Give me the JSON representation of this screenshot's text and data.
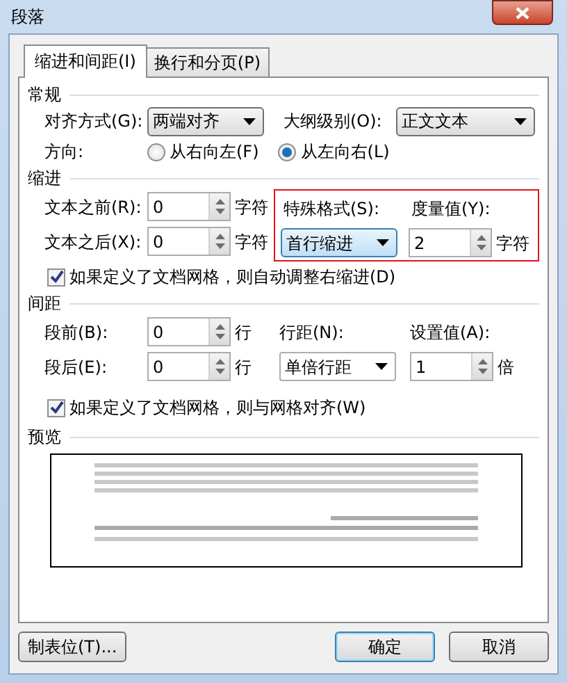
{
  "window": {
    "title": "段落"
  },
  "tabs": [
    {
      "label": "缩进和间距(I)",
      "selected": true
    },
    {
      "label": "换行和分页(P)",
      "selected": false
    }
  ],
  "general": {
    "heading": "常规",
    "alignment": {
      "label": "对齐方式(G):",
      "value": "两端对齐"
    },
    "outline_level": {
      "label": "大纲级别(O):",
      "value": "正文文本"
    },
    "direction": {
      "label": "方向:",
      "options": [
        {
          "label": "从右向左(F)",
          "selected": false
        },
        {
          "label": "从左向右(L)",
          "selected": true
        }
      ]
    }
  },
  "indent": {
    "heading": "缩进",
    "before": {
      "label": "文本之前(R):",
      "value": "0",
      "unit": "字符"
    },
    "after": {
      "label": "文本之后(X):",
      "value": "0",
      "unit": "字符"
    },
    "special": {
      "highlighted": true,
      "label": "特殊格式(S):",
      "value": "首行缩进",
      "measure_label": "度量值(Y):",
      "measure_value": "2",
      "unit": "字符"
    },
    "auto_adjust": {
      "label": "如果定义了文档网格，则自动调整右缩进(D)",
      "checked": true
    }
  },
  "spacing": {
    "heading": "间距",
    "before": {
      "label": "段前(B):",
      "value": "0",
      "unit": "行"
    },
    "after": {
      "label": "段后(E):",
      "value": "0",
      "unit": "行"
    },
    "line_spacing": {
      "label": "行距(N):",
      "value": "单倍行距"
    },
    "setting": {
      "label": "设置值(A):",
      "value": "1",
      "unit": "倍"
    },
    "snap_to_grid": {
      "label": "如果定义了文档网格，则与网格对齐(W)",
      "checked": true
    }
  },
  "preview": {
    "heading": "预览"
  },
  "buttons": [
    {
      "label": "制表位(T)...",
      "kind": "left"
    },
    {
      "label": "确定",
      "kind": "default"
    },
    {
      "label": "取消",
      "kind": "normal"
    }
  ]
}
